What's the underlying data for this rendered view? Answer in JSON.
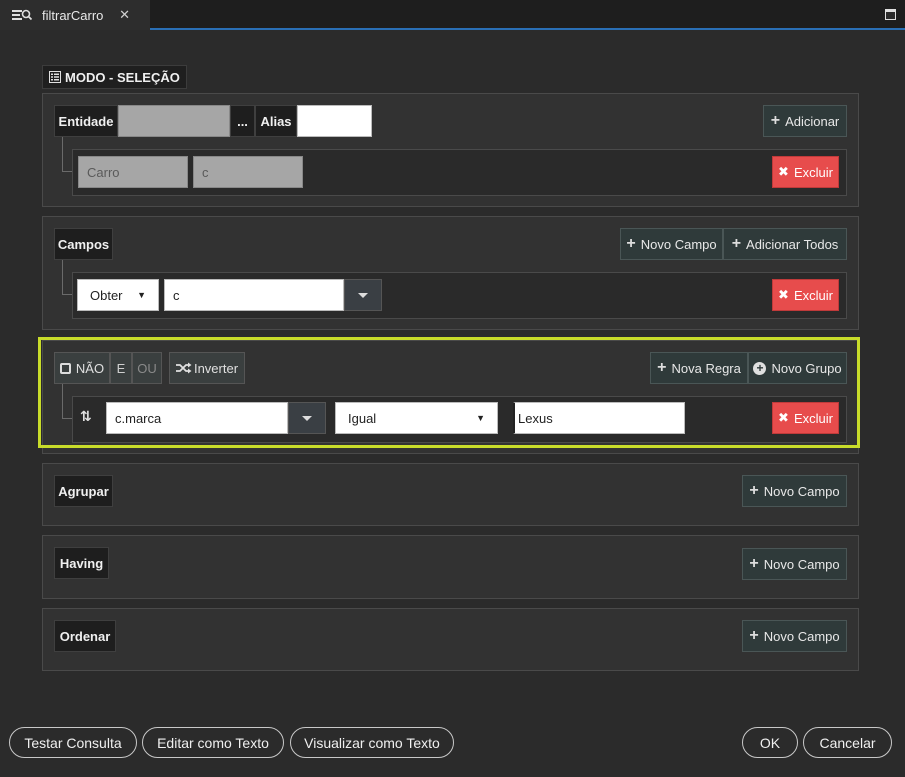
{
  "tab": {
    "title": "filtrarCarro",
    "close": "✕"
  },
  "mode": {
    "label": "MODO - SELEÇÃO"
  },
  "entity": {
    "entity_label": "Entidade",
    "entity_value": "",
    "ellipsis": "...",
    "alias_label": "Alias",
    "alias_value": "",
    "add_label": "Adicionar",
    "row": {
      "entity": "Carro",
      "alias": "c",
      "delete_label": "Excluir"
    }
  },
  "fields": {
    "header": "Campos",
    "new_field_label": "Novo Campo",
    "add_all_label": "Adicionar Todos",
    "row": {
      "mode": "Obter",
      "value": "c",
      "delete_label": "Excluir"
    }
  },
  "rules": {
    "not_label": "NÃO",
    "and_label": "E",
    "or_label": "OU",
    "invert_label": "Inverter",
    "new_rule_label": "Nova Regra",
    "new_group_label": "Novo Grupo",
    "row": {
      "field": "c.marca",
      "operator": "Igual",
      "value": "Lexus",
      "delete_label": "Excluir"
    }
  },
  "group": {
    "header": "Agrupar",
    "new_field_label": "Novo Campo"
  },
  "having": {
    "header": "Having",
    "new_field_label": "Novo Campo"
  },
  "order": {
    "header": "Ordenar",
    "new_field_label": "Novo Campo"
  },
  "footer": {
    "test_label": "Testar Consulta",
    "edit_label": "Editar como Texto",
    "view_label": "Visualizar como Texto",
    "ok_label": "OK",
    "cancel_label": "Cancelar"
  },
  "colors": {
    "accent_blue": "#2a6fb5",
    "danger": "#e74c4c",
    "highlight": "#c8dc2a"
  }
}
